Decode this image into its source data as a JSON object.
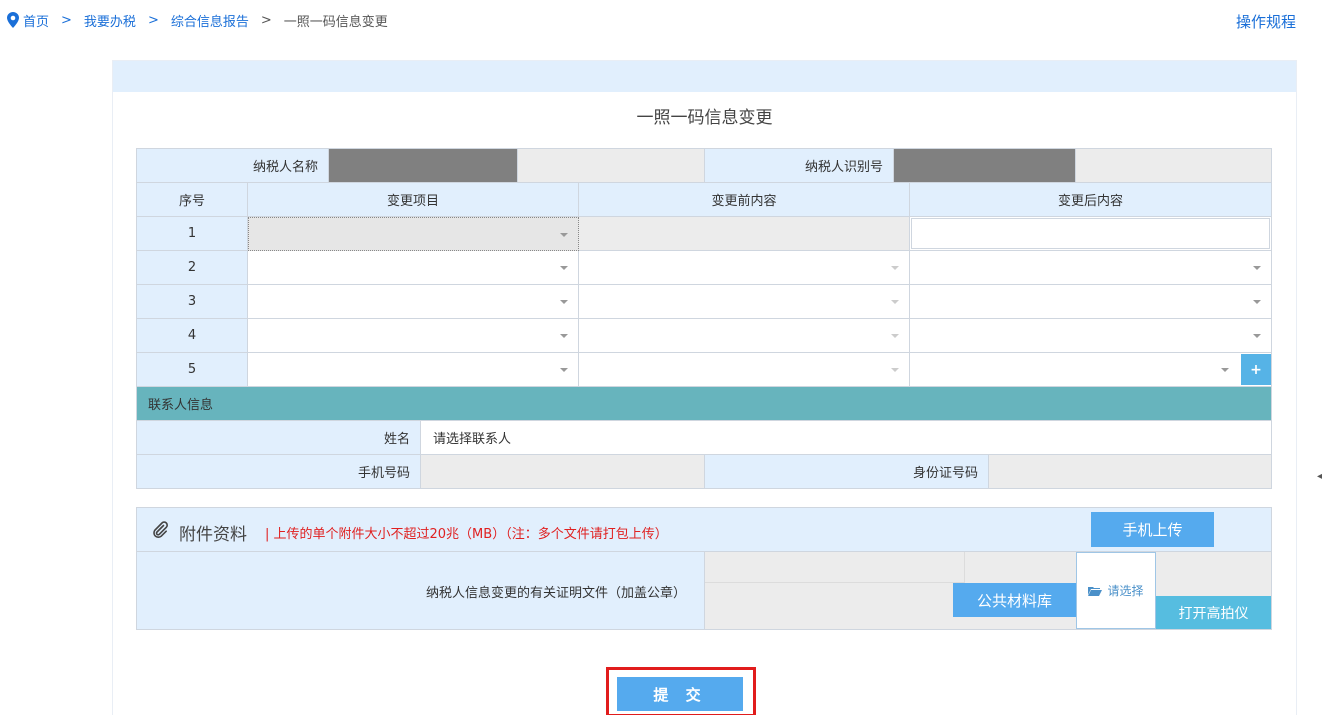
{
  "breadcrumb": {
    "home": "首页",
    "sep": ">",
    "level1": "我要办税",
    "level2": "综合信息报告",
    "current": "一照一码信息变更"
  },
  "help_link": "操作规程",
  "form": {
    "title": "一照一码信息变更",
    "taxpayer_name_label": "纳税人名称",
    "taxpayer_id_label": "纳税人识别号",
    "columns": {
      "index": "序号",
      "item": "变更项目",
      "before": "变更前内容",
      "after": "变更后内容"
    },
    "rows": [
      {
        "num": "1"
      },
      {
        "num": "2"
      },
      {
        "num": "3"
      },
      {
        "num": "4"
      },
      {
        "num": "5"
      }
    ],
    "add_row_label": "+",
    "contact": {
      "section_title": "联系人信息",
      "name_label": "姓名",
      "name_value": "请选择联系人",
      "phone_label": "手机号码",
      "id_label": "身份证号码"
    }
  },
  "attachments": {
    "title": "附件资料",
    "note": "| 上传的单个附件大小不超过20兆（MB）（注：多个文件请打包上传）",
    "mobile_upload": "手机上传",
    "doc_label": "纳税人信息变更的有关证明文件（加盖公章）",
    "public_library": "公共材料库",
    "choose": "请选择",
    "open_camera": "打开高拍仪"
  },
  "submit_label": "提 交",
  "colors": {
    "accent": "#55aaee",
    "header_bg": "#e1effd",
    "section_bar": "#67b4bd",
    "highlight_border": "#e11c1c",
    "note_red": "#e02020"
  }
}
